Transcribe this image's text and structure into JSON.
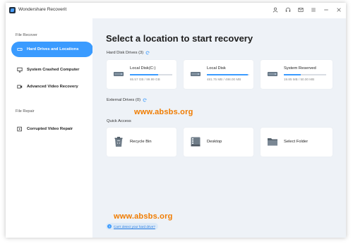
{
  "app": {
    "title": "Wondershare Recoverit"
  },
  "titlebar": {
    "icons": [
      "user-icon",
      "headset-icon",
      "mail-icon",
      "menu-icon",
      "minimize-icon",
      "close-icon"
    ]
  },
  "sidebar": {
    "sections": [
      {
        "label": "File Recover",
        "items": [
          {
            "label": "Hard Drives and Locations",
            "icon": "hard-drive-icon",
            "active": true
          },
          {
            "label": "System Crashed Computer",
            "icon": "monitor-icon",
            "active": false
          },
          {
            "label": "Advanced Video Recovery",
            "icon": "video-icon",
            "active": false
          }
        ]
      },
      {
        "label": "File Repair",
        "items": [
          {
            "label": "Corrupted Video Repair",
            "icon": "video-repair-icon",
            "active": false
          }
        ]
      }
    ]
  },
  "main": {
    "title": "Select a location to start recovery",
    "hard_disk_label": "Hard Disk Drives (3)",
    "drives": [
      {
        "name": "Local Disk(C:)",
        "size": "65.57 GB / 99.99 GB",
        "usage": 0.66
      },
      {
        "name": "Local Disk",
        "size": "481.75 MB / 498.00 MB",
        "usage": 0.97
      },
      {
        "name": "System Reserved",
        "size": "19.85 MB / 50.00 MB",
        "usage": 0.4
      }
    ],
    "external_label": "External Drives (0)",
    "quick_access_label": "Quick Access",
    "quick_access": [
      {
        "name": "Recycle Bin",
        "icon": "recycle-bin-icon"
      },
      {
        "name": "Desktop",
        "icon": "desktop-icon"
      },
      {
        "name": "Select Folder",
        "icon": "folder-icon"
      }
    ],
    "help_link": "Can't detect your hard drive?"
  },
  "watermark": {
    "text": "www.absbs.org"
  },
  "colors": {
    "accent": "#3a9bff",
    "watermark": "#f07c00",
    "main_bg": "#eef2f7"
  }
}
